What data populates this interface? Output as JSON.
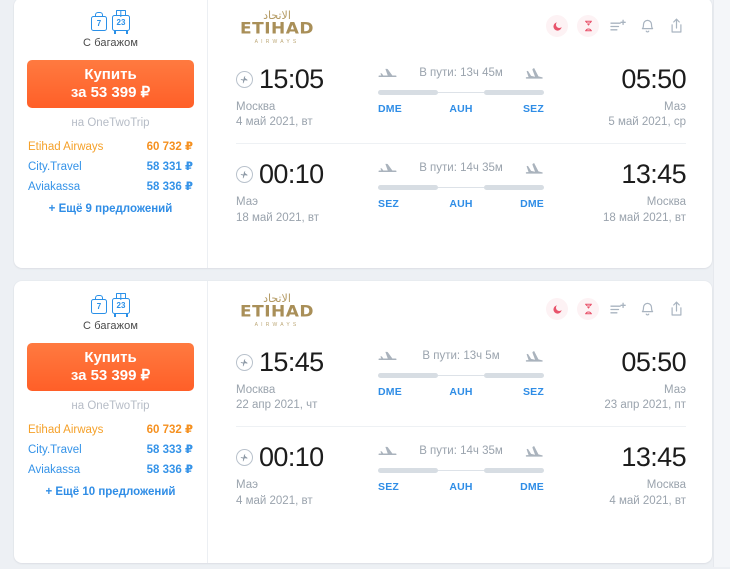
{
  "page": {
    "background_color": "#edf0f4",
    "accent_orange": "#ff6d3a",
    "accent_blue": "#2f8de6",
    "airline_gold": "#a98f58",
    "alert_red": "#e8536b"
  },
  "tickets": [
    {
      "baggage": {
        "cabin_weight": "7",
        "checked_weight": "23",
        "label": "С багажом"
      },
      "buy": {
        "title": "Купить",
        "price": "за 53 399 ₽",
        "agency_note": "на OneTwoTrip"
      },
      "offers": [
        {
          "name": "Etihad Airways",
          "price": "60 732 ₽",
          "highlight": true
        },
        {
          "name": "City.Travel",
          "price": "58 331 ₽",
          "highlight": false
        },
        {
          "name": "Aviakassa",
          "price": "58 336 ₽",
          "highlight": false
        }
      ],
      "more_offers": "+ Ещё 9 предложений",
      "airline": {
        "arabic": "الاتحاد",
        "wordmark": "ETIHAD",
        "sub": "AIRWAYS"
      },
      "header_icons": [
        {
          "name": "night-flight-icon",
          "glyph": "moon"
        },
        {
          "name": "long-layover-icon",
          "glyph": "hourglass"
        },
        {
          "name": "add-to-compare-icon",
          "glyph": "list-plus"
        },
        {
          "name": "price-alert-bell-icon",
          "glyph": "bell"
        },
        {
          "name": "share-icon",
          "glyph": "share"
        }
      ],
      "segments": [
        {
          "depart": {
            "time": "15:05",
            "city": "Москва",
            "date": "4 май 2021, вт",
            "code": "DME"
          },
          "arrive": {
            "time": "05:50",
            "city": "Маэ",
            "date": "5 май 2021, ср",
            "code": "SEZ"
          },
          "duration": "В пути: 13ч 45м",
          "stop_code": "AUH"
        },
        {
          "depart": {
            "time": "00:10",
            "city": "Маэ",
            "date": "18 май 2021, вт",
            "code": "SEZ"
          },
          "arrive": {
            "time": "13:45",
            "city": "Москва",
            "date": "18 май 2021, вт",
            "code": "DME"
          },
          "duration": "В пути: 14ч 35м",
          "stop_code": "AUH"
        }
      ]
    },
    {
      "baggage": {
        "cabin_weight": "7",
        "checked_weight": "23",
        "label": "С багажом"
      },
      "buy": {
        "title": "Купить",
        "price": "за 53 399 ₽",
        "agency_note": "на OneTwoTrip"
      },
      "offers": [
        {
          "name": "Etihad Airways",
          "price": "60 732 ₽",
          "highlight": true
        },
        {
          "name": "City.Travel",
          "price": "58 333 ₽",
          "highlight": false
        },
        {
          "name": "Aviakassa",
          "price": "58 336 ₽",
          "highlight": false
        }
      ],
      "more_offers": "+ Ещё 10 предложений",
      "airline": {
        "arabic": "الاتحاد",
        "wordmark": "ETIHAD",
        "sub": "AIRWAYS"
      },
      "header_icons": [
        {
          "name": "night-flight-icon",
          "glyph": "moon"
        },
        {
          "name": "long-layover-icon",
          "glyph": "hourglass"
        },
        {
          "name": "add-to-compare-icon",
          "glyph": "list-plus"
        },
        {
          "name": "price-alert-bell-icon",
          "glyph": "bell"
        },
        {
          "name": "share-icon",
          "glyph": "share"
        }
      ],
      "segments": [
        {
          "depart": {
            "time": "15:45",
            "city": "Москва",
            "date": "22 апр 2021, чт",
            "code": "DME"
          },
          "arrive": {
            "time": "05:50",
            "city": "Маэ",
            "date": "23 апр 2021, пт",
            "code": "SEZ"
          },
          "duration": "В пути: 13ч 5м",
          "stop_code": "AUH"
        },
        {
          "depart": {
            "time": "00:10",
            "city": "Маэ",
            "date": "4 май 2021, вт",
            "code": "SEZ"
          },
          "arrive": {
            "time": "13:45",
            "city": "Москва",
            "date": "4 май 2021, вт",
            "code": "DME"
          },
          "duration": "В пути: 14ч 35м",
          "stop_code": "AUH"
        }
      ]
    }
  ]
}
